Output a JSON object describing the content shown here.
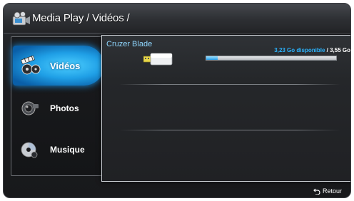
{
  "header": {
    "title": "Media Play / Vidéos /"
  },
  "sidebar": {
    "items": [
      {
        "label": "Vidéos",
        "icon": "video-film-icon",
        "active": true
      },
      {
        "label": "Photos",
        "icon": "camera-icon",
        "active": false
      },
      {
        "label": "Musique",
        "icon": "disc-icon",
        "active": false
      }
    ]
  },
  "device": {
    "name": "Cruzer Blade",
    "free": "3,23 Go disponible",
    "separator": "/",
    "total": "3,55 Go",
    "used_fraction": 0.09
  },
  "footer": {
    "back_label": "Retour",
    "back_icon": "return-arrow-icon"
  },
  "colors": {
    "accent": "#2ab4ff",
    "title": "#8fd7ff",
    "active": "#1f9fe6"
  }
}
